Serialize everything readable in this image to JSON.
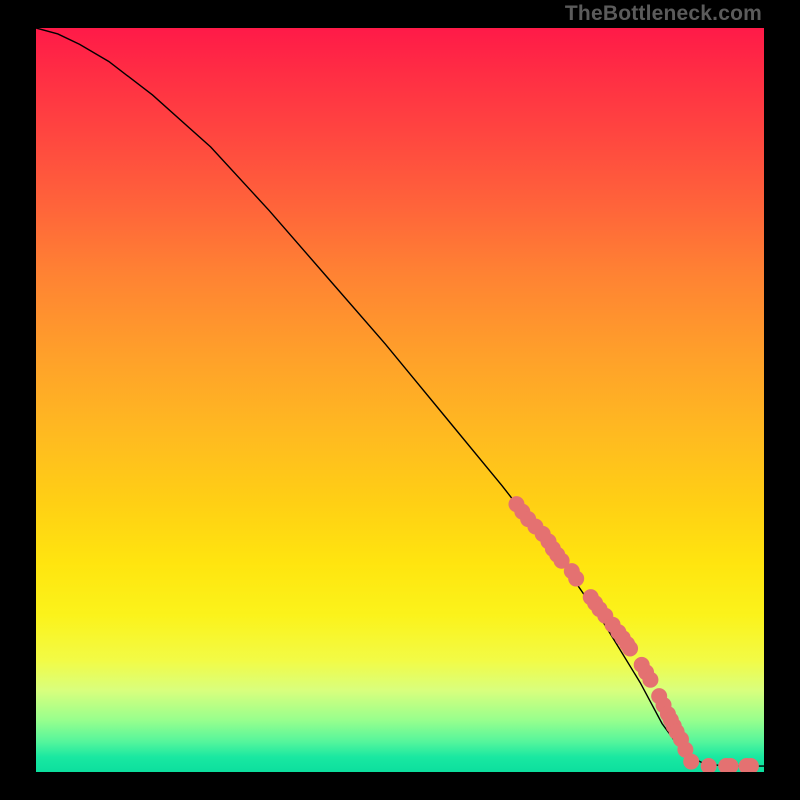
{
  "watermark": "TheBottleneck.com",
  "marker_color": "#e47171",
  "line_color": "#000000",
  "chart_data": {
    "type": "line",
    "title": "",
    "xlabel": "",
    "ylabel": "",
    "xlim": [
      0,
      100
    ],
    "ylim": [
      0,
      100
    ],
    "grid": false,
    "series": [
      {
        "name": "curve",
        "x": [
          0,
          3,
          6,
          10,
          16,
          24,
          32,
          40,
          48,
          56,
          64,
          72,
          78,
          83,
          86,
          89,
          92,
          96,
          100
        ],
        "y": [
          100,
          99.2,
          97.8,
          95.5,
          91.0,
          84.0,
          75.5,
          66.5,
          57.5,
          48.0,
          38.5,
          28.5,
          20.0,
          12.0,
          6.5,
          2.5,
          1.0,
          0.8,
          0.8
        ]
      }
    ],
    "markers": {
      "name": "highlight-points",
      "x": [
        66.0,
        66.8,
        67.6,
        68.6,
        69.6,
        70.4,
        71.0,
        71.6,
        72.2,
        73.6,
        74.2,
        76.2,
        76.8,
        77.4,
        78.2,
        79.2,
        80.0,
        80.6,
        81.2,
        81.6,
        83.2,
        83.8,
        84.4,
        85.6,
        86.2,
        86.8,
        87.2,
        87.6,
        88.0,
        88.6,
        89.2,
        90.0,
        92.4,
        94.8,
        95.4,
        97.6,
        98.2
      ],
      "y": [
        36.0,
        35.0,
        34.0,
        33.0,
        32.0,
        31.0,
        30.0,
        29.2,
        28.4,
        27.0,
        26.0,
        23.5,
        22.7,
        21.9,
        21.0,
        19.8,
        18.8,
        18.0,
        17.2,
        16.6,
        14.4,
        13.4,
        12.4,
        10.2,
        9.0,
        7.8,
        7.0,
        6.2,
        5.4,
        4.4,
        3.0,
        1.4,
        0.8,
        0.8,
        0.8,
        0.8,
        0.8
      ]
    }
  }
}
